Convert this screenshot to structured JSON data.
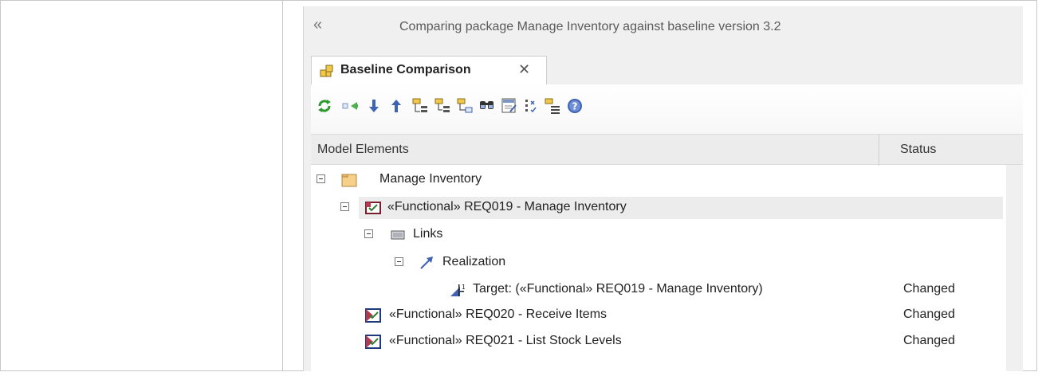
{
  "window": {
    "caption": "Comparing package Manage Inventory against baseline version 3.2"
  },
  "tab": {
    "label": "Baseline Comparison"
  },
  "toolbar": {
    "buttons": [
      "refresh-icon",
      "merge-icon",
      "next-down-icon",
      "previous-up-icon",
      "expand-tree-icon",
      "expand-branch-icon",
      "collapse-icon",
      "find-icon",
      "xml-report-icon",
      "checklist-icon",
      "list-icon",
      "help-icon"
    ]
  },
  "grid": {
    "columns": [
      "Model Elements",
      "Status"
    ],
    "rows": [
      {
        "label": "Manage Inventory",
        "status": "",
        "icon": "folder-icon"
      },
      {
        "label": "«Functional» REQ019 - Manage Inventory",
        "status": "",
        "icon": "requirement-icon"
      },
      {
        "label": "Links",
        "status": "",
        "icon": "links-icon"
      },
      {
        "label": "Realization",
        "status": "",
        "icon": "realization-arrow-icon"
      },
      {
        "label": "Target: («Functional» REQ019 - Manage Inventory)",
        "status": "Changed",
        "icon": "target-icon"
      },
      {
        "label": "«Functional» REQ020 - Receive Items",
        "status": "Changed",
        "icon": "requirement-icon"
      },
      {
        "label": "«Functional» REQ021 - List Stock Levels",
        "status": "Changed",
        "icon": "requirement-icon"
      }
    ]
  }
}
